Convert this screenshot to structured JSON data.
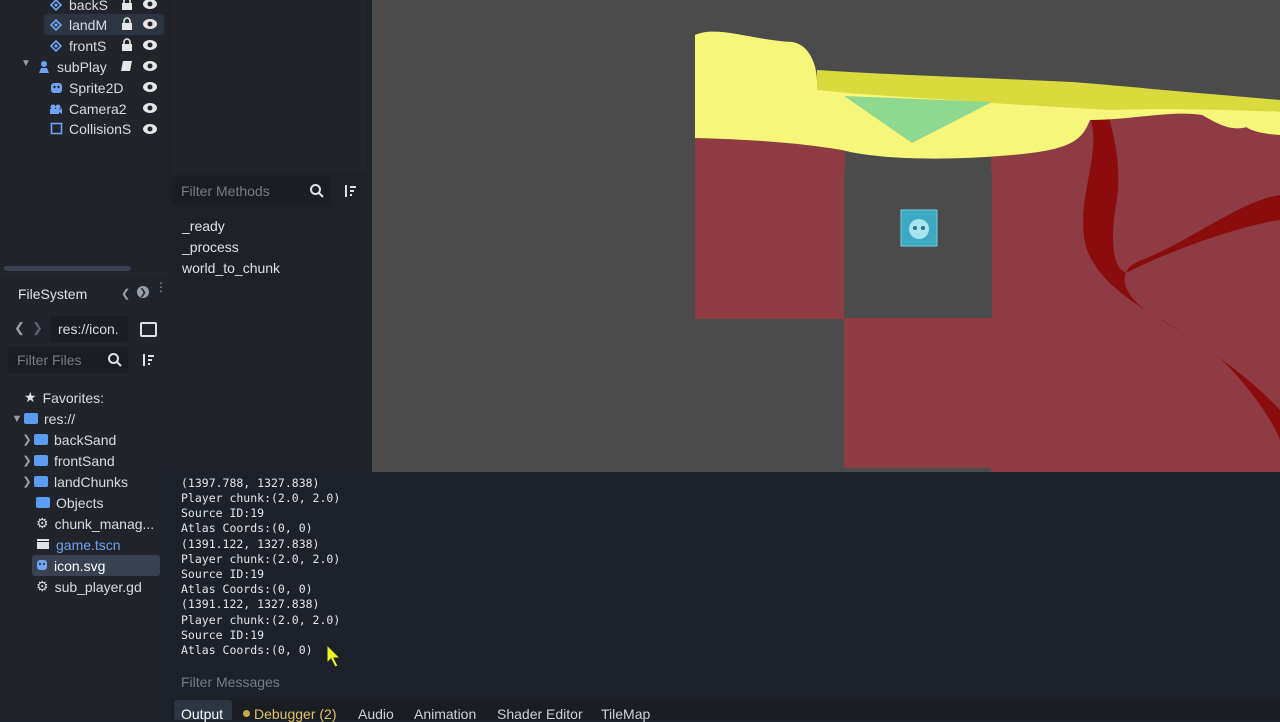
{
  "scene_tree": {
    "items": [
      {
        "label": "backS",
        "icon": "tilemap-layer-icon",
        "locked": true
      },
      {
        "label": "landM",
        "icon": "tilemap-layer-icon",
        "locked": true,
        "selected": true
      },
      {
        "label": "frontS",
        "icon": "tilemap-layer-icon",
        "locked": true
      },
      {
        "label": "subPlay",
        "icon": "character-body-icon",
        "script": true
      },
      {
        "label": "Sprite2D",
        "icon": "sprite-icon"
      },
      {
        "label": "Camera2",
        "icon": "camera-icon"
      },
      {
        "label": "CollisionS",
        "icon": "collision-shape-icon"
      }
    ]
  },
  "methods": {
    "filter_placeholder": "Filter Methods",
    "items": [
      "_ready",
      "_process",
      "world_to_chunk"
    ]
  },
  "filesystem": {
    "title": "FileSystem",
    "path": "res://icon.",
    "filter_placeholder": "Filter Files",
    "favorites_label": "Favorites:",
    "root_label": "res://",
    "items": [
      {
        "label": "backSand",
        "type": "folder",
        "expandable": true
      },
      {
        "label": "frontSand",
        "type": "folder",
        "expandable": true
      },
      {
        "label": "landChunks",
        "type": "folder",
        "expandable": true
      },
      {
        "label": "Objects",
        "type": "folder",
        "expandable": false
      },
      {
        "label": "chunk_manag...",
        "type": "script"
      },
      {
        "label": "game.tscn",
        "type": "scene"
      },
      {
        "label": "icon.svg",
        "type": "image",
        "selected": true
      },
      {
        "label": "sub_player.gd",
        "type": "script"
      }
    ]
  },
  "output": {
    "lines": [
      "(1397.788, 1327.838)",
      "Player chunk:(2.0, 2.0)",
      "Source ID:19",
      "Atlas Coords:(0, 0)",
      "(1391.122, 1327.838)",
      "Player chunk:(2.0, 2.0)",
      "Source ID:19",
      "Atlas Coords:(0, 0)",
      "(1391.122, 1327.838)",
      "Player chunk:(2.0, 2.0)",
      "Source ID:19",
      "Atlas Coords:(0, 0)"
    ],
    "filter_placeholder": "Filter Messages"
  },
  "bottom_tabs": [
    "Output",
    "Debugger (2)",
    "Audio",
    "Animation",
    "Shader Editor",
    "TileMap"
  ],
  "colors": {
    "sand": "#f6f77a",
    "land": "#8f3b44",
    "tunnel": "#8b0c0c",
    "viewport_bg": "#4b4b4b",
    "debugger_dot": "#c9a94a"
  }
}
